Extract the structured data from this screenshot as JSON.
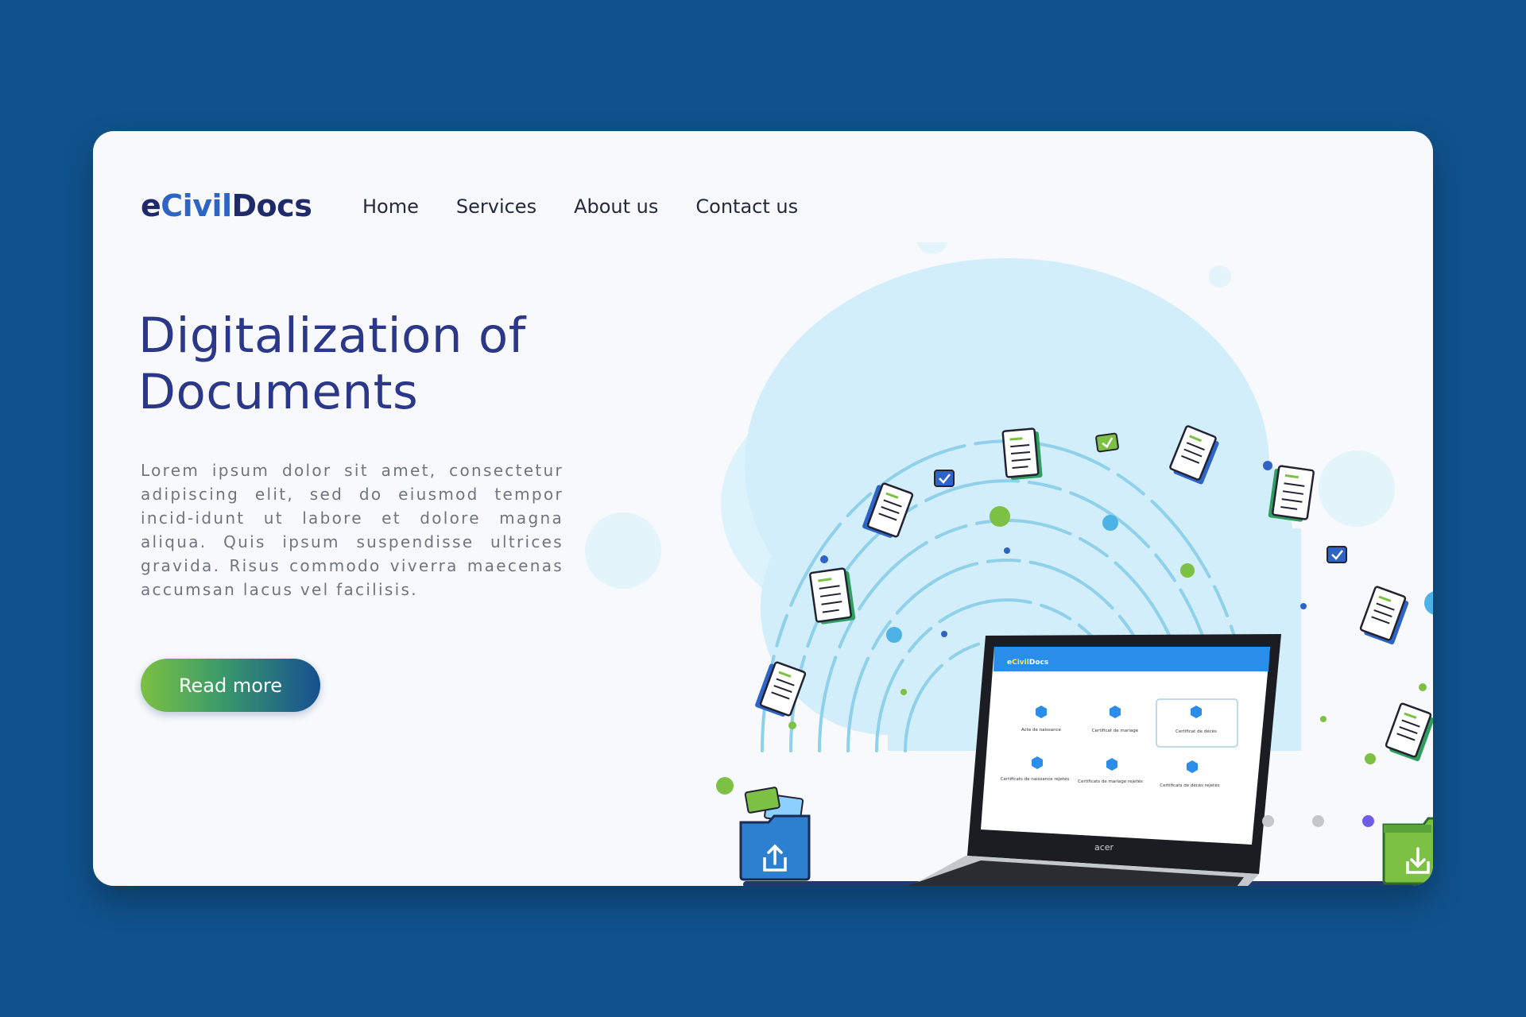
{
  "brand": {
    "part1": "e",
    "part2": "Civil",
    "part3": "Docs"
  },
  "nav": {
    "items": [
      {
        "label": "Home"
      },
      {
        "label": "Services"
      },
      {
        "label": "About us"
      },
      {
        "label": "Contact us"
      }
    ]
  },
  "hero": {
    "title_line1": "Digitalization of",
    "title_line2": "Documents",
    "body": "Lorem ipsum dolor sit amet, consectetur adipiscing elit, sed do eiusmod tempor incid-idunt ut labore et dolore magna aliqua. Quis ipsum suspendisse ultrices gravida. Risus commodo viverra maecenas accumsan lacus vel facilisis.",
    "cta": "Read more"
  },
  "laptop": {
    "brand": "acer",
    "screen": {
      "app_title_part1": "e",
      "app_title_part2": "Civil",
      "app_title_part3": "Docs",
      "cards": [
        {
          "label": "Acte de naissance"
        },
        {
          "label": "Certificat de mariage"
        },
        {
          "label": "Certificat de décès"
        },
        {
          "label": "Certificats de naissance rejetés"
        },
        {
          "label": "Certificats de mariage rejetés"
        },
        {
          "label": "Certificats de décès rejetés"
        }
      ]
    }
  },
  "carousel": {
    "count": 3,
    "active_index": 2
  },
  "colors": {
    "page_bg": "#10528c",
    "card_bg": "#f8f9fc",
    "title": "#2b3788",
    "accent_green": "#7cc143",
    "accent_blue": "#2d64c6",
    "dot_inactive": "#c4c6cc",
    "dot_active": "#6c5ce7"
  },
  "icons": {
    "upload_folder": "upload-folder-icon",
    "download_folder": "download-folder-icon",
    "checkbox": "checkbox-icon",
    "document": "document-icon"
  }
}
